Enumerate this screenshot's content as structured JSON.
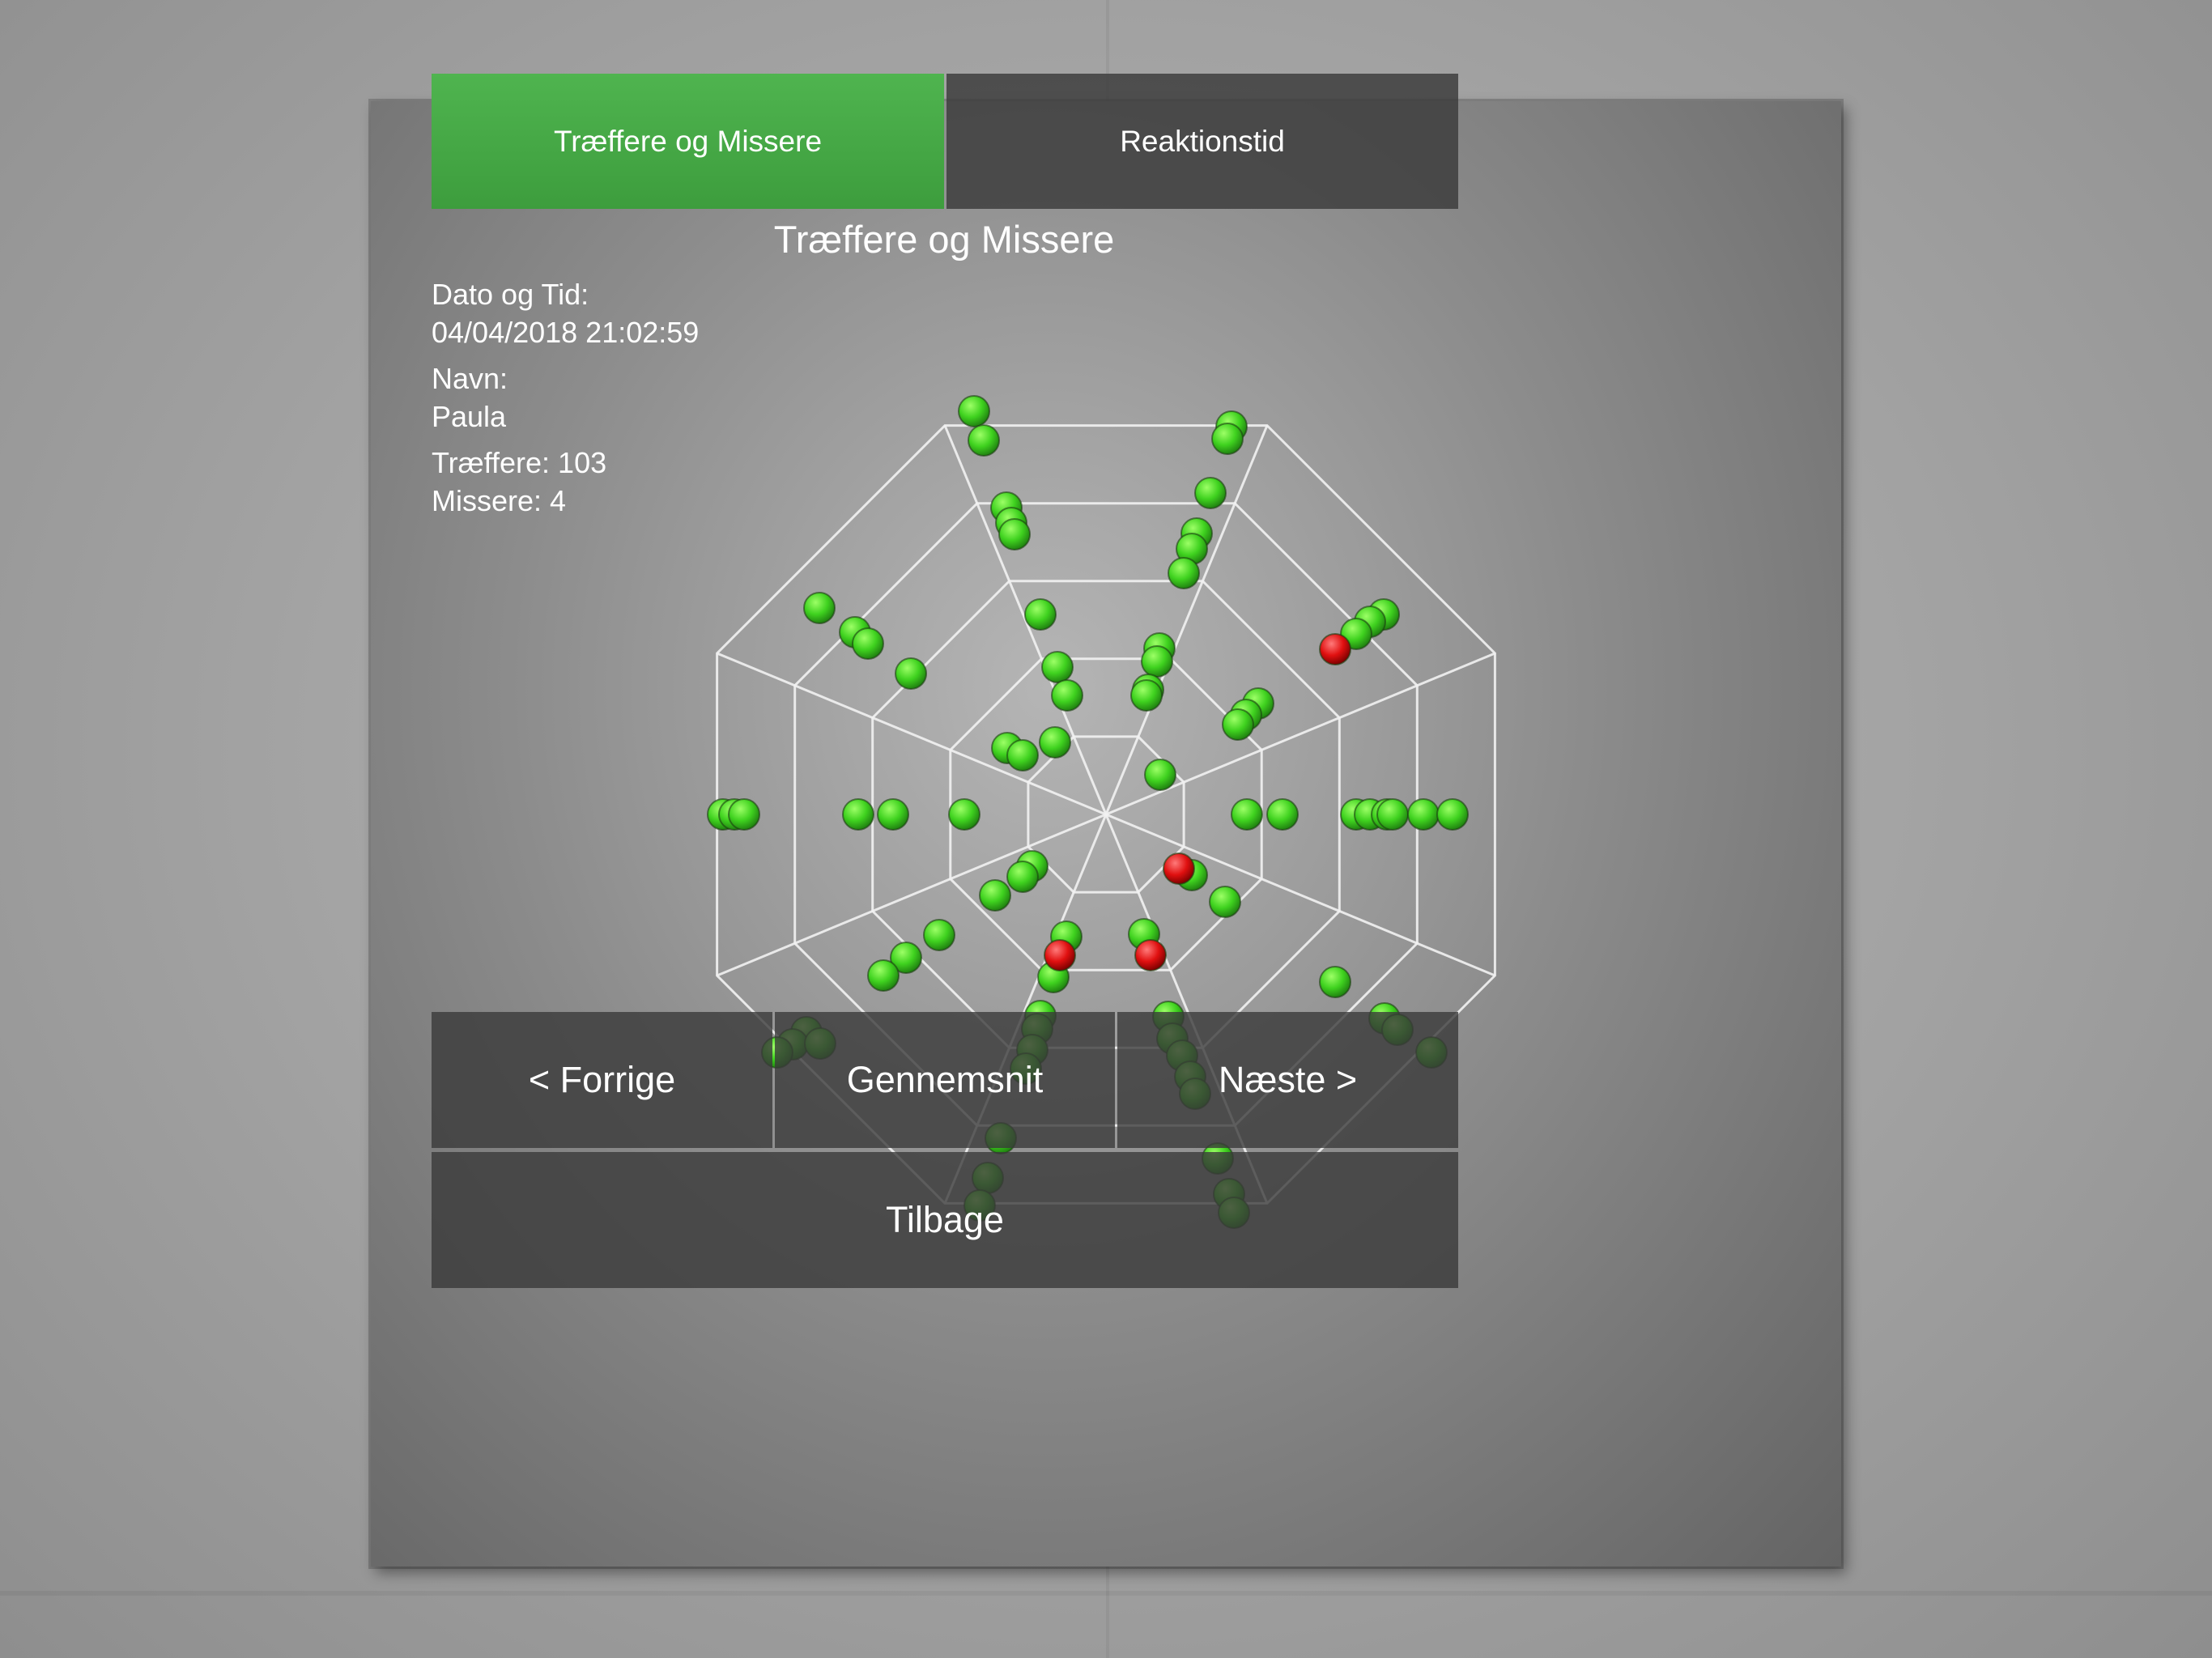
{
  "tabs": {
    "hits_misses": "Træffere og Missere",
    "reaction_time": "Reaktionstid"
  },
  "page_title": "Træffere og Missere",
  "info": {
    "date_label": "Dato og Tid:",
    "date_value": "04/04/2018 21:02:59",
    "name_label": "Navn:",
    "name_value": "Paula",
    "hits_text": "Træffere: 103",
    "misses_text": "Missere: 4",
    "hits": 103,
    "misses": 4
  },
  "buttons": {
    "previous": "< Forrige",
    "average": "Gennemsnit",
    "next": "Næste >",
    "back": "Tilbage"
  },
  "colors": {
    "active_tab": "#46a946",
    "hit": "#3fd21f",
    "miss": "#e01010",
    "web_lines": "#f2f2f2"
  },
  "target": {
    "shape": "octagon-web",
    "rings": 5,
    "spokes": 8
  }
}
